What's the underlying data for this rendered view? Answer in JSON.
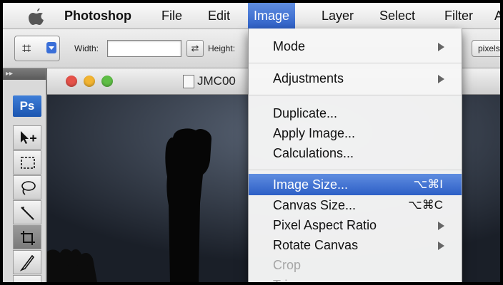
{
  "menubar": {
    "app_name": "Photoshop",
    "items": [
      "File",
      "Edit",
      "Image",
      "Layer",
      "Select",
      "Filter",
      "A"
    ]
  },
  "options_bar": {
    "width_label": "Width:",
    "height_label": "Height:",
    "units_label": "pixels"
  },
  "tools": {
    "logo": "Ps"
  },
  "document": {
    "title": "JMC00"
  },
  "image_menu": {
    "items": [
      {
        "label": "Mode",
        "submenu": true
      },
      {
        "label": "Adjustments",
        "submenu": true
      },
      {
        "label": "Duplicate..."
      },
      {
        "label": "Apply Image..."
      },
      {
        "label": "Calculations..."
      },
      {
        "label": "Image Size...",
        "shortcut": "⌥⌘I",
        "highlighted": true
      },
      {
        "label": "Canvas Size...",
        "shortcut": "⌥⌘C"
      },
      {
        "label": "Pixel Aspect Ratio",
        "submenu": true
      },
      {
        "label": "Rotate Canvas",
        "submenu": true
      },
      {
        "label": "Crop",
        "disabled": true
      },
      {
        "label": "Trim",
        "disabled": true
      }
    ]
  },
  "colors": {
    "menu_highlight": "#3f72d6",
    "close_light": "#e5524a",
    "minimize_light": "#f2b432",
    "zoom_light": "#5fbe46"
  }
}
